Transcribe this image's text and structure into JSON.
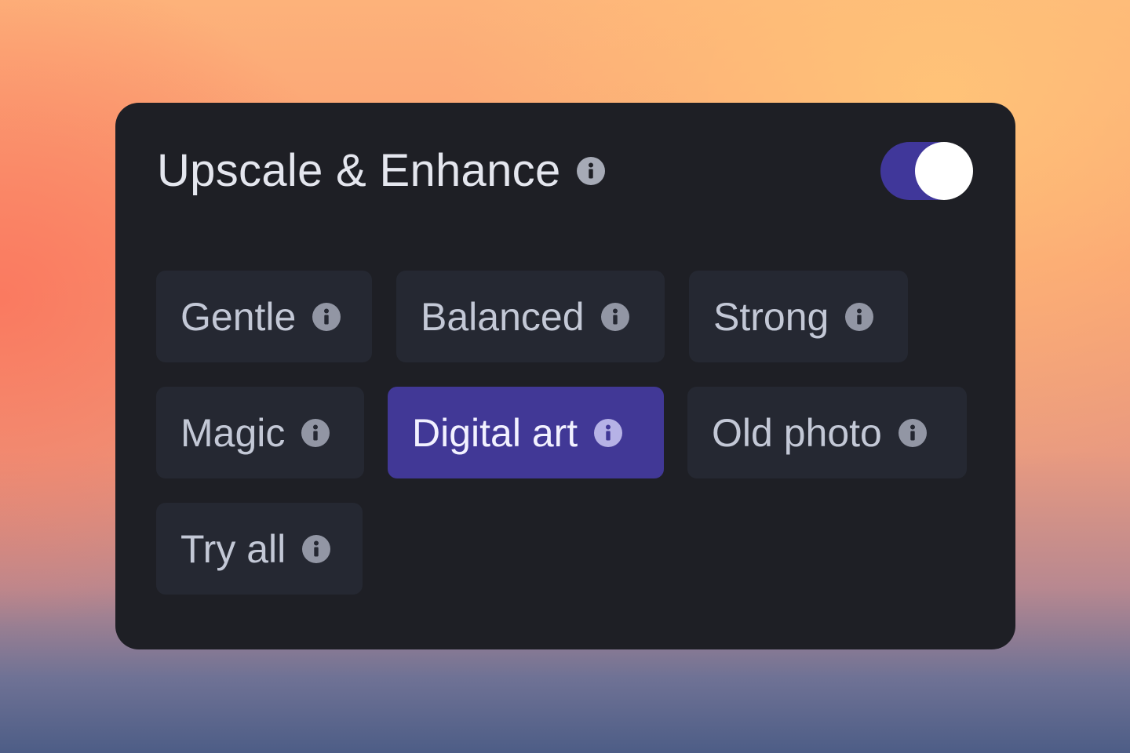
{
  "panel": {
    "title": "Upscale & Enhance",
    "title_info_icon": "info-icon",
    "toggle": {
      "state": "on",
      "accent_color": "#40379a"
    }
  },
  "options": [
    {
      "label": "Gentle",
      "icon": "info-icon",
      "selected": false
    },
    {
      "label": "Balanced",
      "icon": "info-icon",
      "selected": false
    },
    {
      "label": "Strong",
      "icon": "info-icon",
      "selected": false
    },
    {
      "label": "Magic",
      "icon": "info-icon",
      "selected": false
    },
    {
      "label": "Digital art",
      "icon": "info-icon",
      "selected": true
    },
    {
      "label": "Old photo",
      "icon": "info-icon",
      "selected": false
    },
    {
      "label": "Try all",
      "icon": "info-icon",
      "selected": false
    }
  ],
  "colors": {
    "panel_background": "#1e1f25",
    "chip_background": "#252832",
    "selected_chip_background": "#413896"
  }
}
